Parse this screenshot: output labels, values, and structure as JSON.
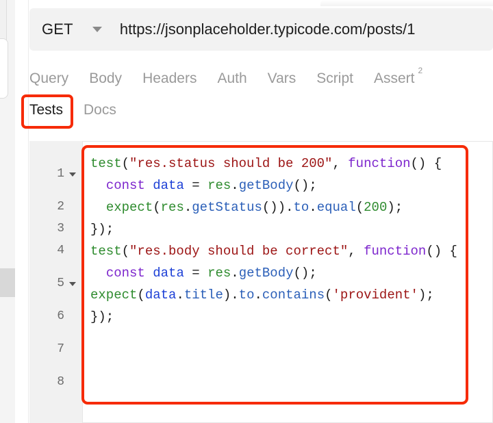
{
  "request_bar": {
    "method": "GET",
    "method_caret_icon": "chevron-down-icon",
    "url": "https://jsonplaceholder.typicode.com/posts/1"
  },
  "tabs_primary": [
    {
      "label": "Query",
      "active": false
    },
    {
      "label": "Body",
      "active": false
    },
    {
      "label": "Headers",
      "active": false
    },
    {
      "label": "Auth",
      "active": false
    },
    {
      "label": "Vars",
      "active": false
    },
    {
      "label": "Script",
      "active": false
    },
    {
      "label": "Assert",
      "active": false,
      "badge": "2"
    }
  ],
  "tabs_secondary": [
    {
      "label": "Tests",
      "active": true
    },
    {
      "label": "Docs",
      "active": false
    }
  ],
  "editor": {
    "gutter": [
      {
        "num": "1",
        "fold": true
      },
      {
        "num": "2",
        "fold": false
      },
      {
        "num": "3",
        "fold": false
      },
      {
        "num": "4",
        "fold": false
      },
      {
        "num": "5",
        "fold": true
      },
      {
        "num": "6",
        "fold": false
      },
      {
        "num": "7",
        "fold": false
      },
      {
        "num": "8",
        "fold": false
      }
    ],
    "lines": [
      [
        {
          "t": "test",
          "c": "t-fn"
        },
        {
          "t": "(",
          "c": "t-plain"
        },
        {
          "t": "\"res.status should be 200\"",
          "c": "t-str"
        },
        {
          "t": ", ",
          "c": "t-plain"
        },
        {
          "t": "function",
          "c": "t-kw"
        },
        {
          "t": "() {",
          "c": "t-plain"
        }
      ],
      [
        {
          "t": "  ",
          "c": "t-plain"
        },
        {
          "t": "const ",
          "c": "t-kw"
        },
        {
          "t": "data",
          "c": "t-var"
        },
        {
          "t": " = ",
          "c": "t-plain"
        },
        {
          "t": "res",
          "c": "t-fn"
        },
        {
          "t": ".",
          "c": "t-plain"
        },
        {
          "t": "getBody",
          "c": "t-prop"
        },
        {
          "t": "();",
          "c": "t-plain"
        }
      ],
      [
        {
          "t": "  ",
          "c": "t-plain"
        },
        {
          "t": "expect",
          "c": "t-fn"
        },
        {
          "t": "(",
          "c": "t-plain"
        },
        {
          "t": "res",
          "c": "t-fn"
        },
        {
          "t": ".",
          "c": "t-plain"
        },
        {
          "t": "getStatus",
          "c": "t-prop"
        },
        {
          "t": "()).",
          "c": "t-plain"
        },
        {
          "t": "to",
          "c": "t-prop"
        },
        {
          "t": ".",
          "c": "t-plain"
        },
        {
          "t": "equal",
          "c": "t-prop"
        },
        {
          "t": "(",
          "c": "t-plain"
        },
        {
          "t": "200",
          "c": "t-num"
        },
        {
          "t": ");",
          "c": "t-plain"
        }
      ],
      [
        {
          "t": "});",
          "c": "t-plain"
        }
      ],
      [
        {
          "t": "test",
          "c": "t-fn"
        },
        {
          "t": "(",
          "c": "t-plain"
        },
        {
          "t": "\"res.body should be correct\"",
          "c": "t-str"
        },
        {
          "t": ", ",
          "c": "t-plain"
        },
        {
          "t": "function",
          "c": "t-kw"
        },
        {
          "t": "() {",
          "c": "t-plain"
        }
      ],
      [
        {
          "t": "  ",
          "c": "t-plain"
        },
        {
          "t": "const ",
          "c": "t-kw"
        },
        {
          "t": "data",
          "c": "t-var"
        },
        {
          "t": " = ",
          "c": "t-plain"
        },
        {
          "t": "res",
          "c": "t-fn"
        },
        {
          "t": ".",
          "c": "t-plain"
        },
        {
          "t": "getBody",
          "c": "t-prop"
        },
        {
          "t": "();",
          "c": "t-plain"
        }
      ],
      [
        {
          "t": "expect",
          "c": "t-fn"
        },
        {
          "t": "(",
          "c": "t-plain"
        },
        {
          "t": "data",
          "c": "t-var"
        },
        {
          "t": ".",
          "c": "t-plain"
        },
        {
          "t": "title",
          "c": "t-prop"
        },
        {
          "t": ").",
          "c": "t-plain"
        },
        {
          "t": "to",
          "c": "t-prop"
        },
        {
          "t": ".",
          "c": "t-plain"
        },
        {
          "t": "contains",
          "c": "t-prop"
        },
        {
          "t": "(",
          "c": "t-plain"
        },
        {
          "t": "'provident'",
          "c": "t-str"
        },
        {
          "t": ");",
          "c": "t-plain"
        }
      ],
      [
        {
          "t": "});",
          "c": "t-plain"
        }
      ]
    ]
  },
  "annotations": {
    "color": "#f62b07",
    "tests_tab_highlight": true,
    "code_panel_highlight": true
  },
  "scrollbar": {
    "thumb_color": "#d8d8d8",
    "track_color": "#f4f4f4"
  }
}
